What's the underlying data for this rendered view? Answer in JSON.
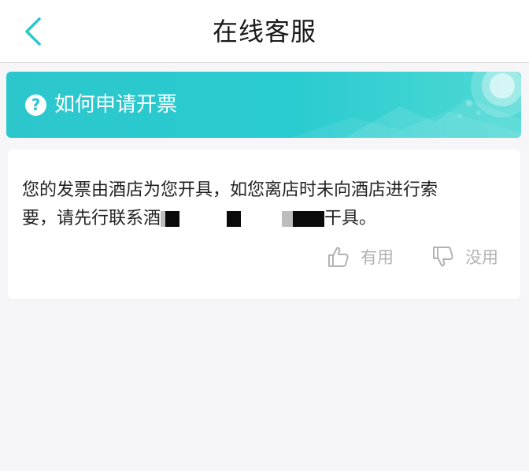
{
  "nav": {
    "title": "在线客服",
    "back_icon": "chevron-left-icon",
    "accent_color": "#2cc6cc"
  },
  "banner": {
    "icon": "question-circle-icon",
    "title": "如何申请开票",
    "gradient_start": "#2cc7cd",
    "gradient_end": "#4fd9d4"
  },
  "answer": {
    "line1": "您的发票由酒店为您开具，如您离店时未向酒店进行索",
    "line2_prefix": "要，请先行联系酒",
    "line2_suffix": "干具。",
    "redacted": true
  },
  "feedback": {
    "useful_label": "有用",
    "useful_icon": "thumbs-up-icon",
    "useless_label": "没用",
    "useless_icon": "thumbs-down-icon"
  }
}
